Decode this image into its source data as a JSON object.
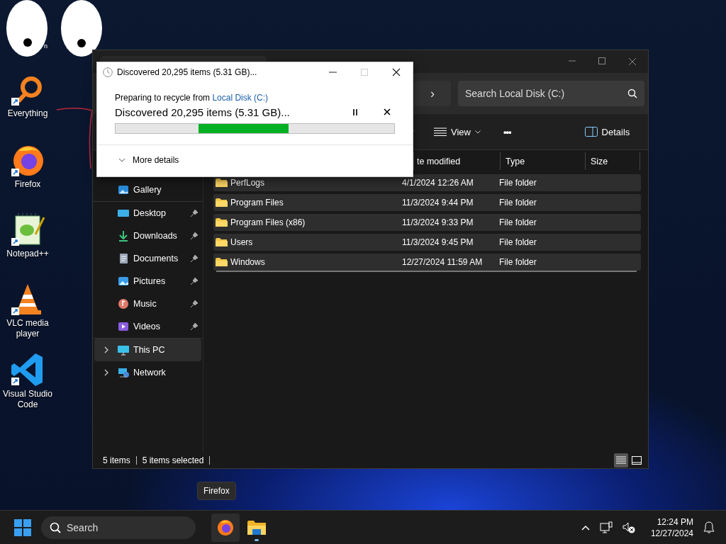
{
  "desktop": {
    "eyes_label": "n",
    "icons": [
      {
        "kind": "everything",
        "label": "Everything",
        "shortcut": true
      },
      {
        "kind": "firefox",
        "label": "Firefox",
        "shortcut": true
      },
      {
        "kind": "notepad",
        "label": "Notepad++",
        "shortcut": true
      },
      {
        "kind": "vlc",
        "label": "VLC media player",
        "shortcut": true
      },
      {
        "kind": "vscode",
        "label": "Visual Studio Code",
        "shortcut": true
      }
    ]
  },
  "explorer": {
    "nav_caret": "›",
    "search": {
      "placeholder": "Search Local Disk (C:)"
    },
    "toolbar": [
      {
        "kind": "caret"
      },
      {
        "kind": "view",
        "label": "View"
      },
      {
        "kind": "more",
        "label": "•••"
      },
      {
        "kind": "details",
        "label": "Details"
      }
    ],
    "sidebar": {
      "sections": [
        {
          "items": [
            {
              "kind": "gallery",
              "label": "Gallery",
              "pinned": false,
              "selected": false
            }
          ]
        },
        {
          "items": [
            {
              "kind": "desktop",
              "label": "Desktop",
              "pinned": true,
              "selected": false
            },
            {
              "kind": "downloads",
              "label": "Downloads",
              "pinned": true,
              "selected": false
            },
            {
              "kind": "documents",
              "label": "Documents",
              "pinned": true,
              "selected": false
            },
            {
              "kind": "pictures",
              "label": "Pictures",
              "pinned": true,
              "selected": false
            },
            {
              "kind": "music",
              "label": "Music",
              "pinned": true,
              "selected": false
            },
            {
              "kind": "videos",
              "label": "Videos",
              "pinned": true,
              "selected": false
            }
          ]
        },
        {
          "items": [
            {
              "kind": "pc",
              "label": "This PC",
              "pinned": false,
              "selected": true,
              "expanded": false
            },
            {
              "kind": "network",
              "label": "Network",
              "pinned": false,
              "selected": false,
              "expanded": false
            }
          ]
        }
      ]
    },
    "table": {
      "columns": [
        "te modified",
        "Type",
        "Size"
      ],
      "rows": [
        {
          "name": "PerfLogs",
          "date": "4/1/2024 12:26 AM",
          "type": "File folder",
          "selected": true
        },
        {
          "name": "Program Files",
          "date": "11/3/2024 9:44 PM",
          "type": "File folder",
          "selected": true
        },
        {
          "name": "Program Files (x86)",
          "date": "11/3/2024 9:33 PM",
          "type": "File folder",
          "selected": true
        },
        {
          "name": "Users",
          "date": "11/3/2024 9:45 PM",
          "type": "File folder",
          "selected": true
        },
        {
          "name": "Windows",
          "date": "12/27/2024 11:59 AM",
          "type": "File folder",
          "selected": true
        }
      ]
    },
    "status_bar": {
      "item_count": "5 items",
      "selection": "5 items selected",
      "views": [
        {
          "kind": "details",
          "selected": true
        },
        {
          "kind": "tiles",
          "selected": false
        }
      ]
    }
  },
  "dialog": {
    "title": "Discovered 20,295 items (5.31 GB)...",
    "source_prefix": "Preparing to recycle from",
    "source_link": "Local Disk (C:)",
    "status": "Discovered 20,295 items (5.31 GB)...",
    "progress": {
      "level": 0.62
    },
    "more_details": "More details",
    "expanded": false,
    "maximize_disabled": true
  },
  "taskbar": {
    "search": {
      "placeholder": "Search"
    },
    "tooltip": "Firefox",
    "apps": [
      {
        "kind": "firefox",
        "hovered": true,
        "running": false
      },
      {
        "kind": "explorer",
        "hovered": false,
        "running": true
      }
    ],
    "tray": {
      "time": "12:24 PM",
      "date": "12/27/2024"
    }
  }
}
